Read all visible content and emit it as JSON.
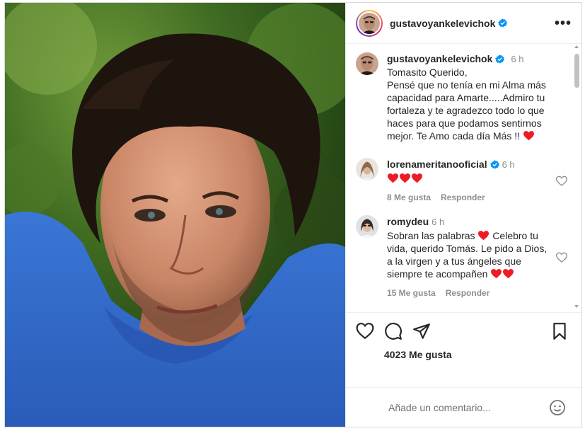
{
  "post": {
    "image_alt": "Hombre de cabello oscuro con camiseta azul sobre fondo de árboles",
    "author": "gustavoyankelevichok",
    "verified": true
  },
  "caption": {
    "author": "gustavoyankelevichok",
    "time": "6 h",
    "text": "Tomasito Querido,\nPensé que no tenía en mi Alma más capacidad para Amarte.....Admiro tu fortaleza y te agradezco todo lo que haces para que podamos sentirnos mejor. Te Amo cada día Más !!"
  },
  "comments": [
    {
      "author": "lorenameritanooficial",
      "verified": true,
      "time": "6 h",
      "hearts": 3,
      "likes": "8 Me gusta",
      "reply": "Responder"
    },
    {
      "author": "romydeu",
      "verified": false,
      "time": "6 h",
      "text_1": "Sobran las palabras",
      "text_2": "Celebro tu vida, querido Tomás. Le pido a Dios, a la virgen y a tus ángeles que siempre te acompañen",
      "likes": "15 Me gusta",
      "reply": "Responder"
    }
  ],
  "actions": {
    "like_icon": "heart-outline-icon",
    "comment_icon": "speech-bubble-icon",
    "share_icon": "paper-plane-icon",
    "save_icon": "bookmark-icon"
  },
  "likes_text": "4023 Me gusta",
  "add_comment": {
    "placeholder": "Añade un comentario..."
  },
  "colors": {
    "verified": "#0095f6",
    "heart": "#ed1c24",
    "muted": "#8e8e8e"
  }
}
